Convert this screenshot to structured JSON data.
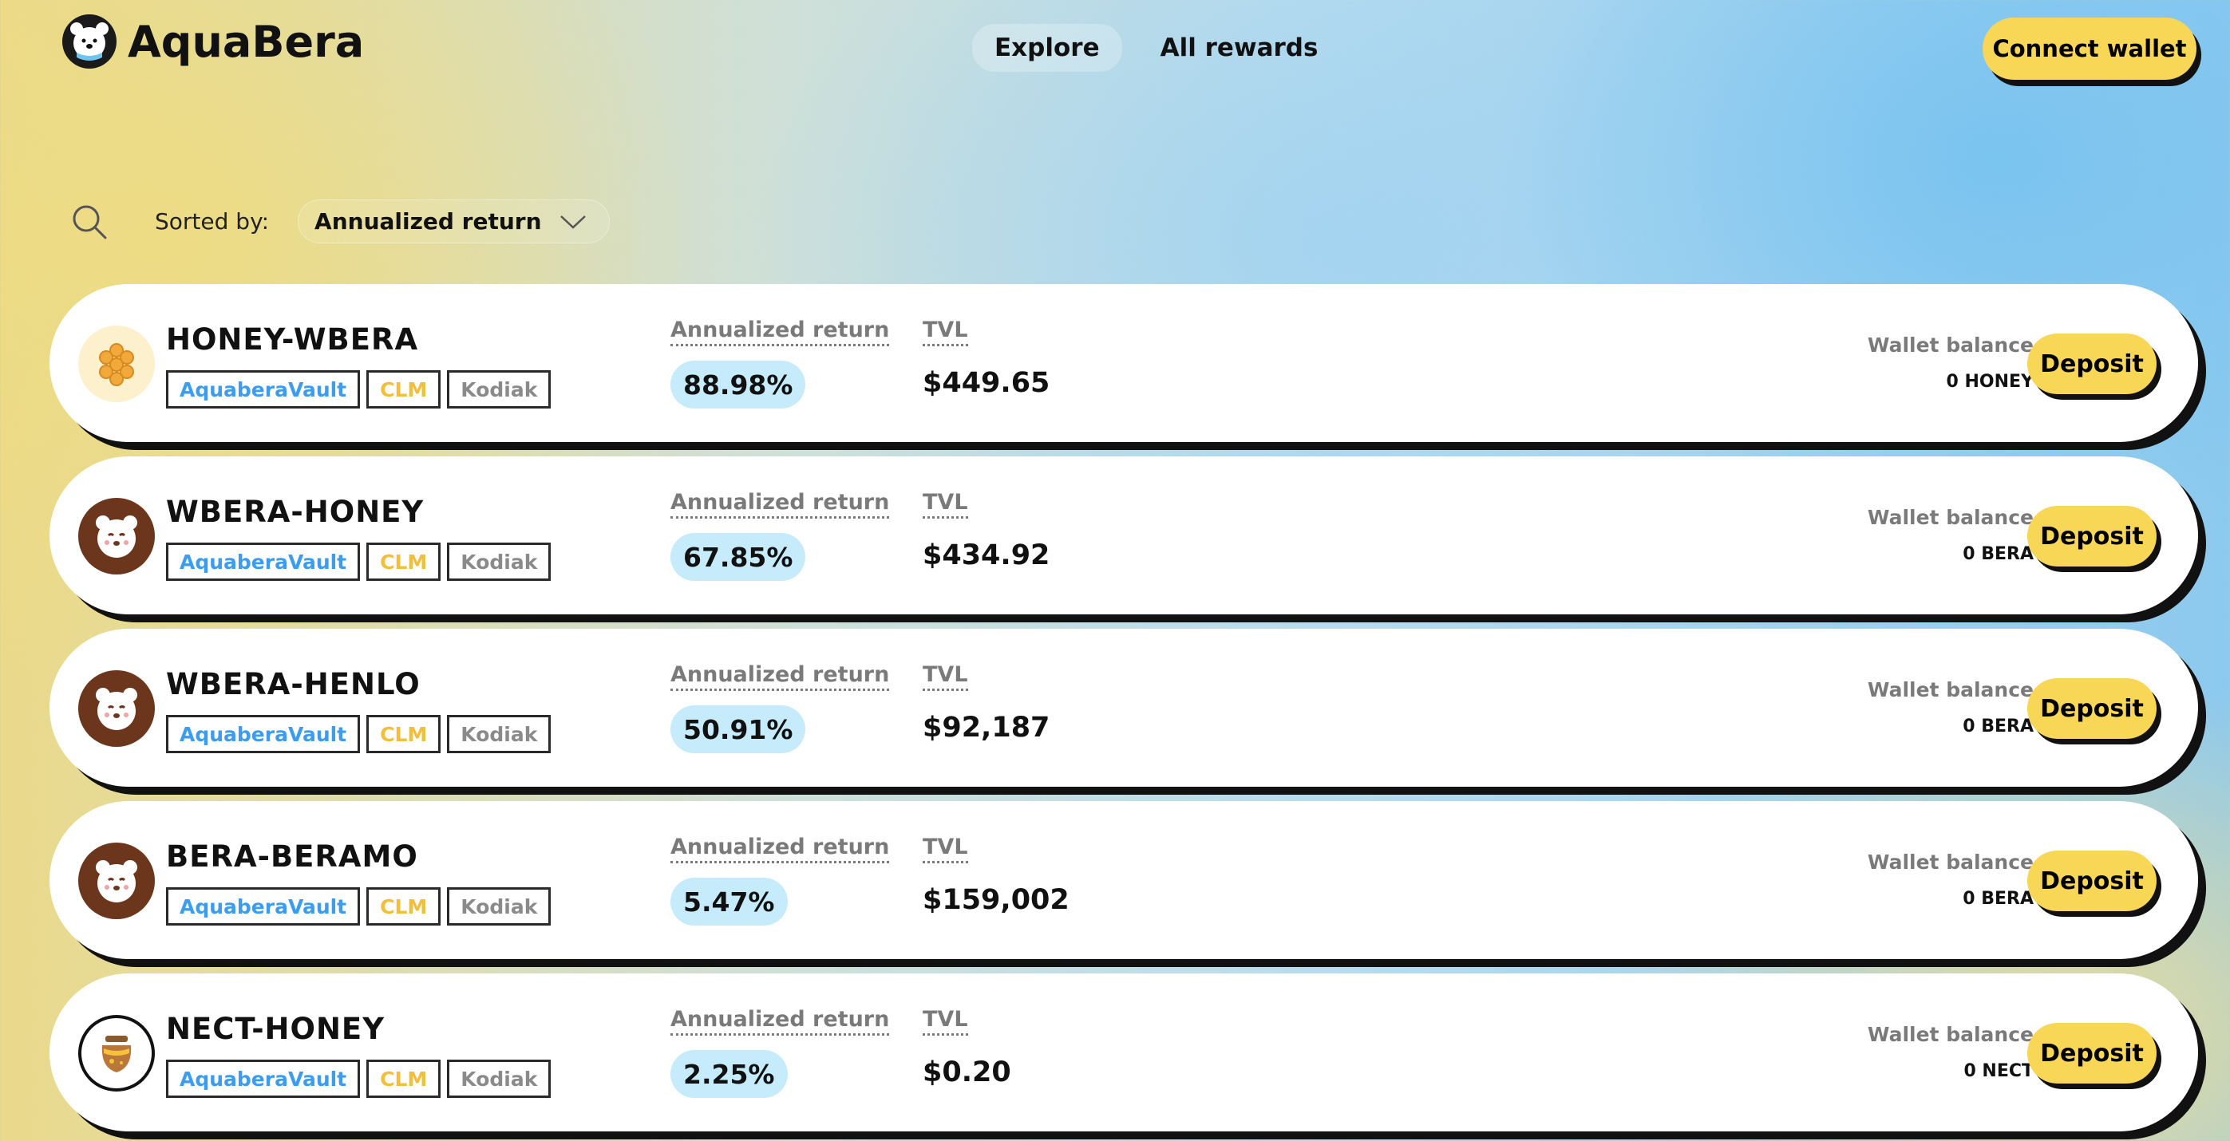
{
  "header": {
    "brand": "AquaBera",
    "nav": [
      "Explore",
      "All rewards"
    ],
    "connect_label": "Connect wallet"
  },
  "toolbar": {
    "sorted_by_label": "Sorted by:",
    "sort_value": "Annualized return"
  },
  "vaults": [
    {
      "name": "HONEY-WBERA",
      "icon": "honeycomb-icon",
      "tags": [
        "AquaberaVault",
        "CLM",
        "Kodiak"
      ],
      "apr_label": "Annualized return",
      "apr": "88.98%",
      "tvl_label": "TVL",
      "tvl": "$449.65",
      "wallet_label": "Wallet balance",
      "wallet_balance": "0 HONEY",
      "deposit_label": "Deposit"
    },
    {
      "name": "WBERA-HONEY",
      "icon": "bear-icon",
      "tags": [
        "AquaberaVault",
        "CLM",
        "Kodiak"
      ],
      "apr_label": "Annualized return",
      "apr": "67.85%",
      "tvl_label": "TVL",
      "tvl": "$434.92",
      "wallet_label": "Wallet balance",
      "wallet_balance": "0 BERA",
      "deposit_label": "Deposit"
    },
    {
      "name": "WBERA-HENLO",
      "icon": "bear-icon",
      "tags": [
        "AquaberaVault",
        "CLM",
        "Kodiak"
      ],
      "apr_label": "Annualized return",
      "apr": "50.91%",
      "tvl_label": "TVL",
      "tvl": "$92,187",
      "wallet_label": "Wallet balance",
      "wallet_balance": "0 BERA",
      "deposit_label": "Deposit"
    },
    {
      "name": "BERA-BERAMO",
      "icon": "bear-icon",
      "tags": [
        "AquaberaVault",
        "CLM",
        "Kodiak"
      ],
      "apr_label": "Annualized return",
      "apr": "5.47%",
      "tvl_label": "TVL",
      "tvl": "$159,002",
      "wallet_label": "Wallet balance",
      "wallet_balance": "0 BERA",
      "deposit_label": "Deposit"
    },
    {
      "name": "NECT-HONEY",
      "icon": "honey-pot-icon",
      "tags": [
        "AquaberaVault",
        "CLM",
        "Kodiak"
      ],
      "apr_label": "Annualized return",
      "apr": "2.25%",
      "tvl_label": "TVL",
      "tvl": "$0.20",
      "wallet_label": "Wallet balance",
      "wallet_balance": "0 NECT",
      "deposit_label": "Deposit"
    }
  ]
}
